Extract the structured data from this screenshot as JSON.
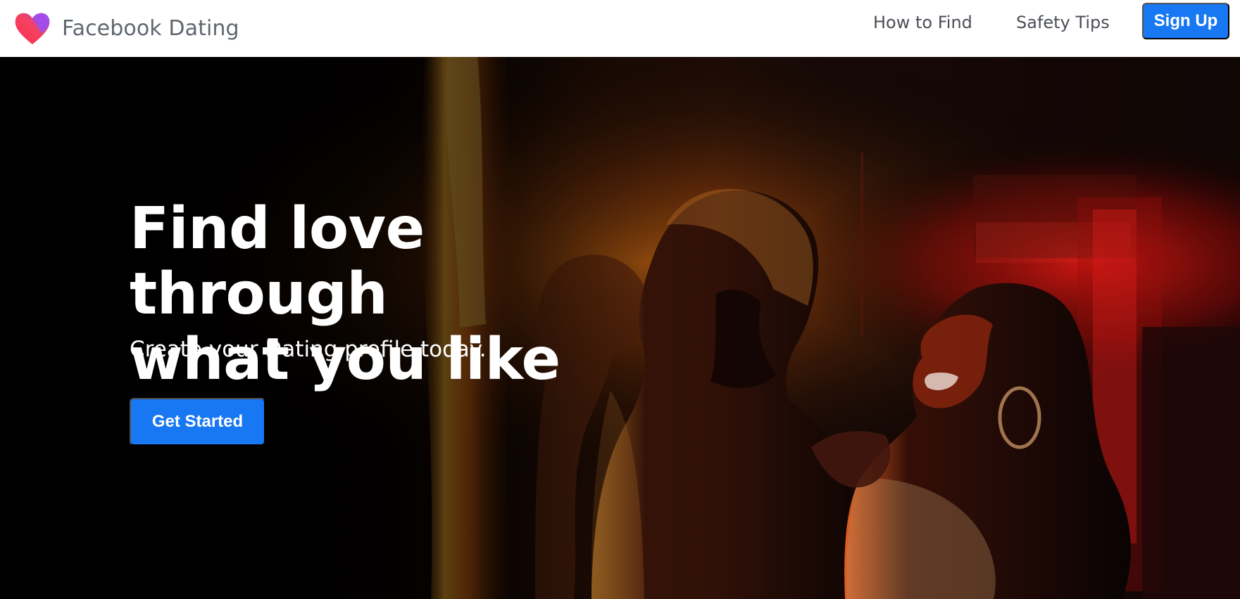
{
  "header": {
    "brand_name": "Facebook Dating",
    "logo_icon": "heart-icon",
    "nav": {
      "how_to_find": "How to Find",
      "safety_tips": "Safety Tips",
      "sign_up": "Sign Up"
    }
  },
  "hero": {
    "headline_line1": "Find love through",
    "headline_line2": "what you like",
    "subtitle": "Create your Dating profile today.",
    "cta_label": "Get Started"
  },
  "colors": {
    "primary_blue": "#1877f2",
    "nav_text": "#4b4f56",
    "brand_text": "#606770",
    "heart_pink": "#f3425f",
    "heart_purple": "#9e4ef0"
  }
}
